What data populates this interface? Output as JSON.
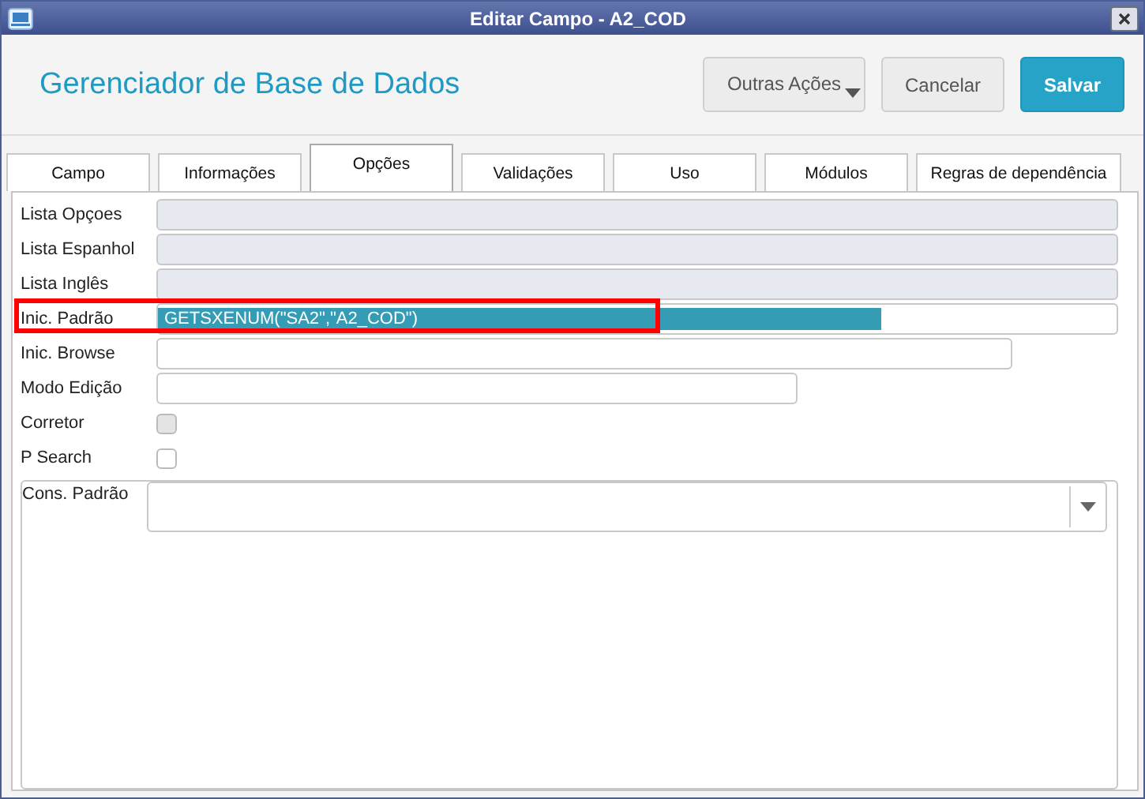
{
  "window": {
    "title": "Editar Campo - A2_COD"
  },
  "header": {
    "title": "Gerenciador de Base de Dados",
    "buttons": [
      {
        "label": "Outras Ações",
        "kind": "menu"
      },
      {
        "label": "Cancelar",
        "kind": "plain"
      },
      {
        "label": "Salvar",
        "kind": "primary"
      }
    ]
  },
  "tabs": [
    {
      "label": "Campo",
      "selected": false
    },
    {
      "label": "Informações",
      "selected": false
    },
    {
      "label": "Opções",
      "selected": true
    },
    {
      "label": "Validações",
      "selected": false
    },
    {
      "label": "Uso",
      "selected": false
    },
    {
      "label": "Módulos",
      "selected": false
    },
    {
      "label": "Regras de dependência",
      "selected": false
    }
  ],
  "fields": [
    {
      "label": "Lista Opçoes",
      "kind": "text",
      "disabled": true
    },
    {
      "label": "Lista Espanhol",
      "kind": "text",
      "disabled": true
    },
    {
      "label": "Lista Inglês",
      "kind": "text",
      "disabled": true
    },
    {
      "label": "Inic. Padrão",
      "kind": "text",
      "disabled": false,
      "value": "GETSXENUM(\"SA2\",\"A2_COD\")",
      "selected": true,
      "highlighted": true
    },
    {
      "label": "Inic. Browse",
      "kind": "text",
      "disabled": false
    },
    {
      "label": "Modo Edição",
      "kind": "text",
      "disabled": false
    },
    {
      "label": "Corretor",
      "kind": "checkbox",
      "disabled": true,
      "checked": false
    },
    {
      "label": "P Search",
      "kind": "checkbox",
      "disabled": false,
      "checked": false
    },
    {
      "label": "Cons. Padrão",
      "kind": "combo",
      "disabled": false
    }
  ]
}
